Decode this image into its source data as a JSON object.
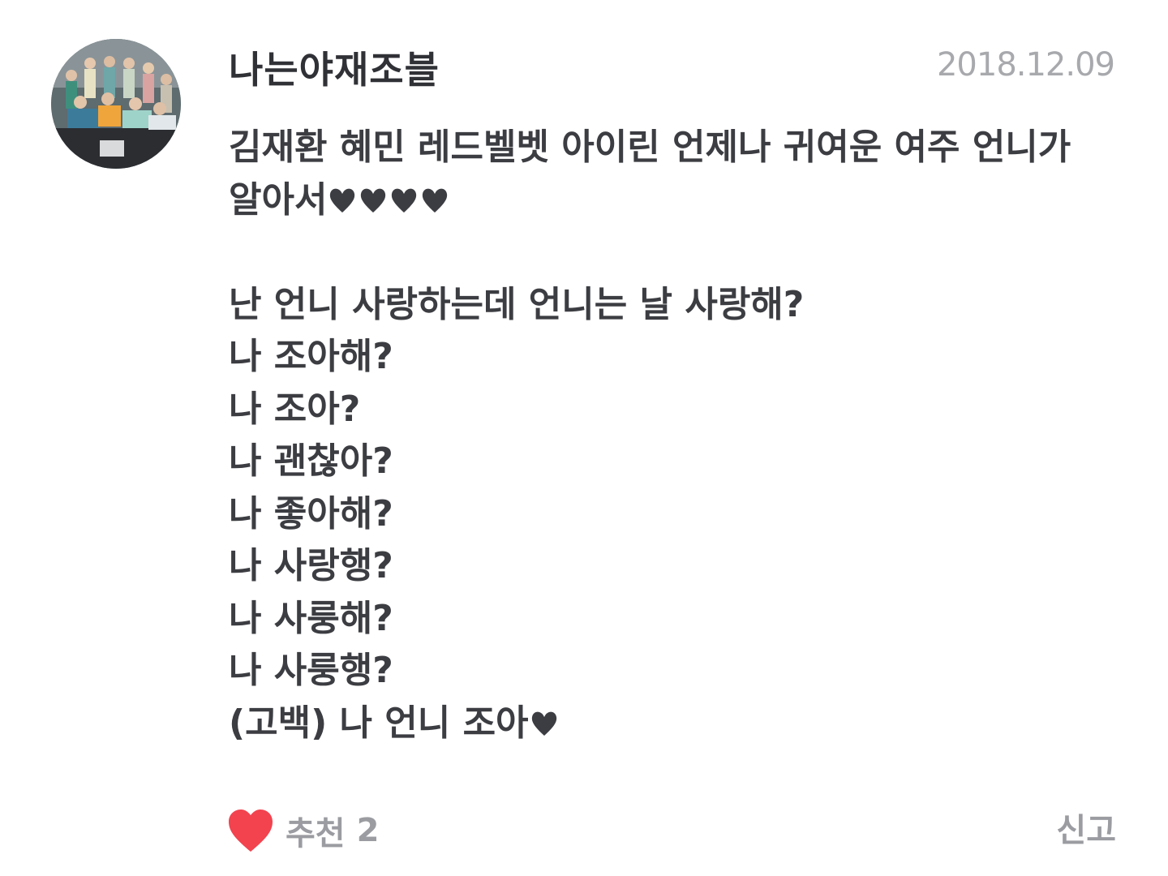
{
  "post": {
    "username": "나는야재조블",
    "date": "2018.12.09",
    "line1": "김재환 혜민 레드벨벳 아이린 언제나 귀여운 여주 언니가",
    "line2": "알아서",
    "line3": "",
    "line4": "난 언니 사랑하는데 언니는 날 사랑해?",
    "line5": "나 조아해?",
    "line6": "나 조아?",
    "line7": "나 괜찮아?",
    "line8": "나 좋아해?",
    "line9": "나 사랑행?",
    "line10": "나 사룽해?",
    "line11": "나 사룽행?",
    "line12": "(고백)  나 언니 조아"
  },
  "footer": {
    "recommend_label": "추천",
    "recommend_count": "2",
    "report_label": "신고"
  },
  "colors": {
    "text": "#3c3d42",
    "meta": "#a8a9ad",
    "like_heart": "#f2434f",
    "emoji_heart": "#3c3d42"
  },
  "icons": {
    "avatar": "profile-photo",
    "like": "heart-icon",
    "inline_heart": "heart-icon"
  }
}
